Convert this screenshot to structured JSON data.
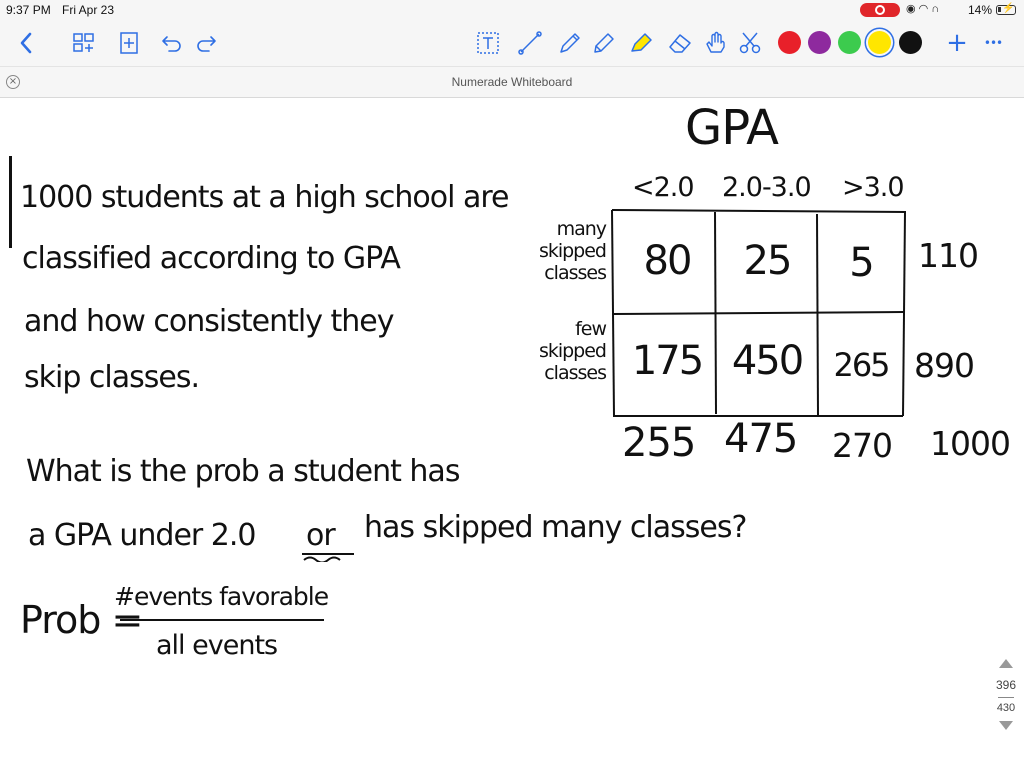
{
  "status": {
    "time": "9:37 PM",
    "date": "Fri Apr 23",
    "battery": "14%",
    "recording_color": "#e0262a"
  },
  "toolbar": {
    "tools": [
      "back-icon",
      "pages-icon",
      "add-page-icon",
      "undo-icon",
      "redo-icon",
      "text-tool-icon",
      "line-tool-icon",
      "pen-icon",
      "pencil-icon",
      "highlighter-icon",
      "eraser-icon",
      "hand-icon",
      "scissors-icon"
    ],
    "colors": [
      "#e8202a",
      "#8e2a9e",
      "#3ccb4e",
      "#ffe600",
      "#111111"
    ],
    "selected_color": "#ffe600",
    "add_label": "+",
    "more_label": "•••",
    "accent": "#2f6fe4"
  },
  "window": {
    "title": "Numerade Whiteboard",
    "close_label": "×"
  },
  "whiteboard": {
    "problem_lines": [
      "1000 students at a high school are",
      "classified according to GPA",
      "and how consistently they",
      "skip classes."
    ],
    "table": {
      "title": "GPA",
      "columns": [
        "<2.0",
        "2.0-3.0",
        ">3.0"
      ],
      "row_labels": [
        [
          "many",
          "skipped",
          "classes"
        ],
        [
          "few",
          "skipped",
          "classes"
        ]
      ],
      "cells": [
        [
          "80",
          "25",
          "5"
        ],
        [
          "175",
          "450",
          "265"
        ]
      ],
      "row_totals": [
        "110",
        "890"
      ],
      "col_totals": [
        "255",
        "475",
        "270"
      ],
      "grand_total": "1000"
    },
    "question_lines": [
      "What is the prob a student has",
      "a GPA under 2.0",
      "or",
      "has skipped many classes?"
    ],
    "formula": {
      "lhs": "Prob =",
      "numerator": "#events favorable",
      "denominator": "all events"
    }
  },
  "pager": {
    "current": "396",
    "total": "430"
  }
}
